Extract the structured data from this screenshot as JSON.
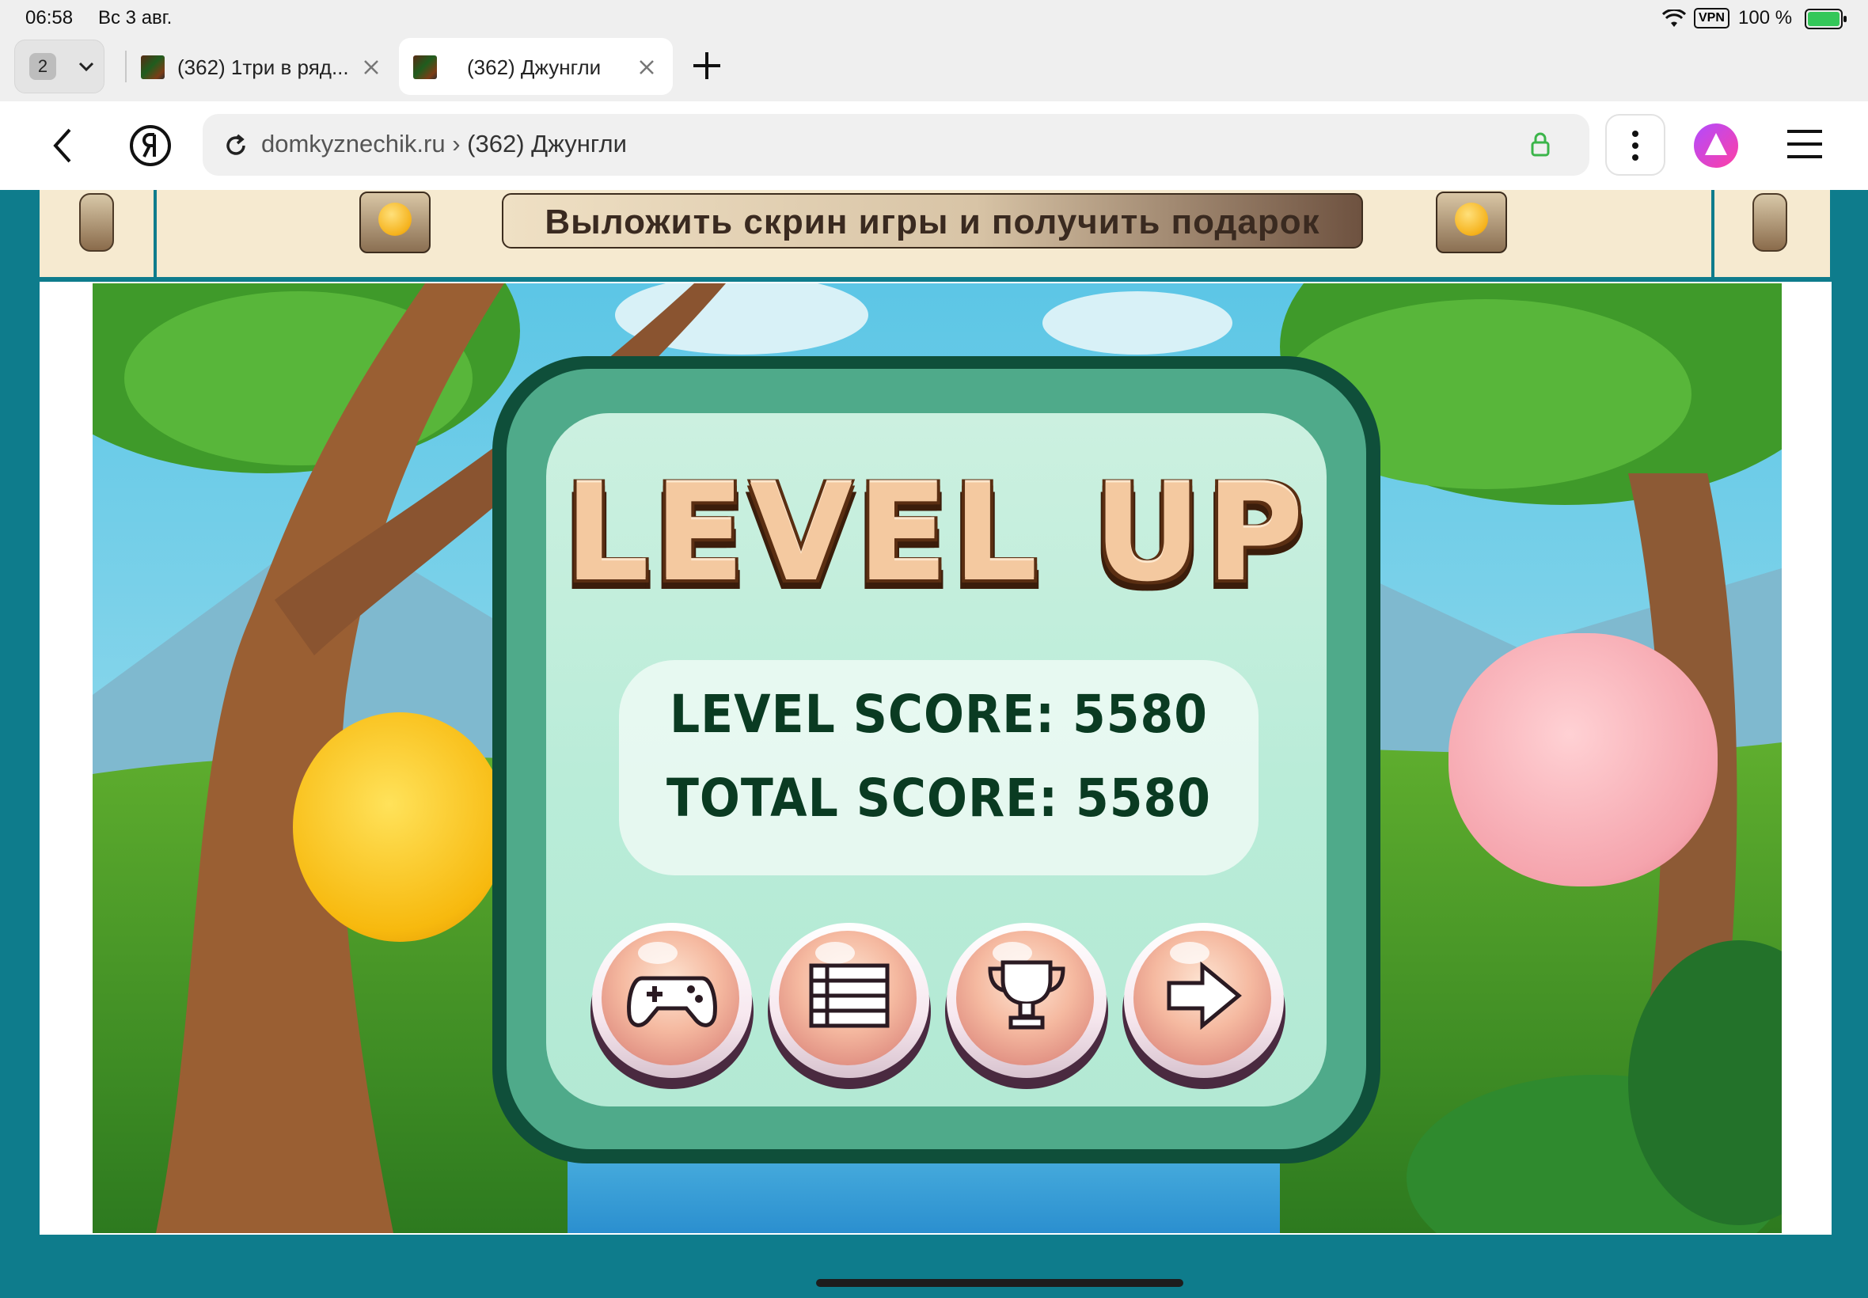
{
  "status_bar": {
    "time": "06:58",
    "date": "Вс 3 авг.",
    "vpn": "VPN",
    "battery": "100 %"
  },
  "tabs": {
    "count": "2",
    "items": [
      {
        "title": "(362) 1три в ряд..."
      },
      {
        "title": "(362) Джунгли"
      }
    ]
  },
  "address_bar": {
    "domain": "domkyznechik.ru",
    "separator": "›",
    "page_title": "(362) Джунгли"
  },
  "banner": {
    "button_label": "Выложить скрин игры и получить подарок"
  },
  "game": {
    "heading": "LEVEL UP",
    "level_score_label": "LEVEL SCORE: 5580",
    "total_score_label": "TOTAL SCORE: 5580",
    "buttons": [
      {
        "icon": "gamepad-icon"
      },
      {
        "icon": "menu-list-icon"
      },
      {
        "icon": "trophy-icon"
      },
      {
        "icon": "arrow-right-icon"
      }
    ]
  },
  "colors": {
    "page_bg": "#0e7c8c",
    "dialog_border": "#0f4f3a",
    "dialog_fill": "#b9ecd8",
    "score_text": "#0a3b22",
    "heading_fill": "#f4c9a0"
  }
}
